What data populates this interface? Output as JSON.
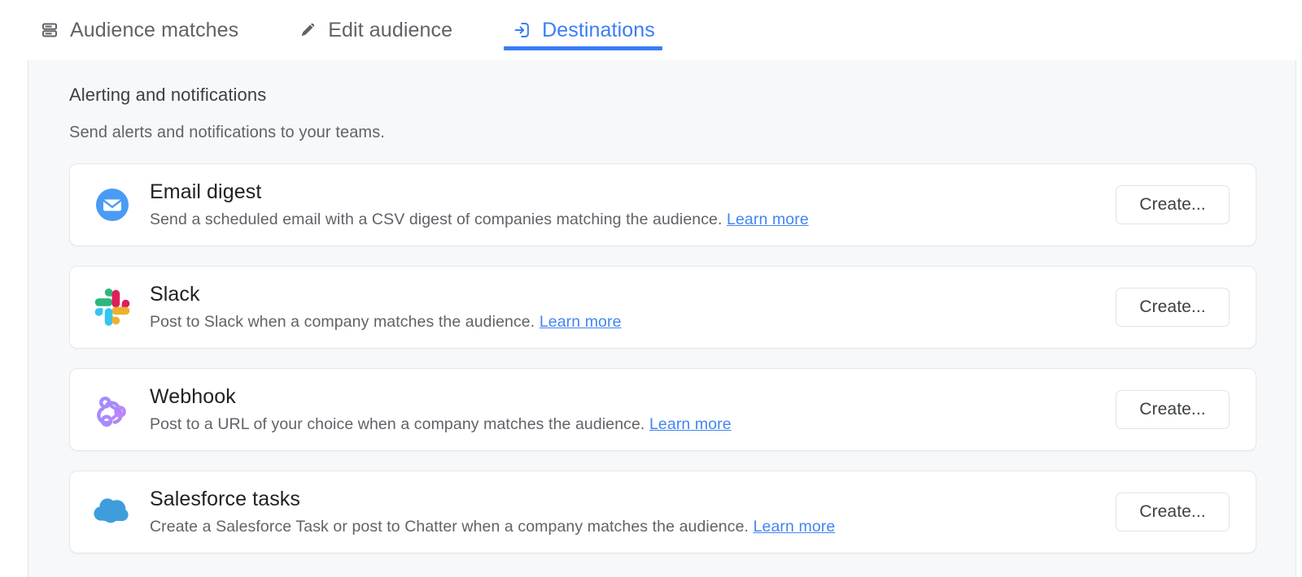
{
  "tabs": [
    {
      "id": "audience-matches",
      "label": "Audience matches",
      "icon": "layers-icon",
      "active": false
    },
    {
      "id": "edit-audience",
      "label": "Edit audience",
      "icon": "pencil-icon",
      "active": false
    },
    {
      "id": "destinations",
      "label": "Destinations",
      "icon": "arrow-into-box-icon",
      "active": true
    }
  ],
  "section": {
    "title": "Alerting and notifications",
    "subtitle": "Send alerts and notifications to your teams."
  },
  "link_label": "Learn more",
  "button_label": "Create...",
  "colors": {
    "accent": "#3b7df6",
    "link": "#4285f4",
    "panel_bg": "#f7f8fa",
    "card_bg": "#ffffff",
    "email_icon": "#4a9bf5",
    "salesforce_icon": "#3f9ddb",
    "webhook_icon": "#a78bfa",
    "slack_blue": "#36c5f0",
    "slack_green": "#2eb67d",
    "slack_red": "#e01e5a",
    "slack_yellow": "#ecb22e"
  },
  "destinations": [
    {
      "id": "email-digest",
      "title": "Email digest",
      "description": "Send a scheduled email with a CSV digest of companies matching the audience.",
      "link_label": "Learn more",
      "button_label": "Create...",
      "icon": "email-icon"
    },
    {
      "id": "slack",
      "title": "Slack",
      "description": "Post to Slack when a company matches the audience.",
      "link_label": "Learn more",
      "button_label": "Create...",
      "icon": "slack-icon"
    },
    {
      "id": "webhook",
      "title": "Webhook",
      "description": "Post to a URL of your choice when a company matches the audience.",
      "link_label": "Learn more",
      "button_label": "Create...",
      "icon": "webhook-icon"
    },
    {
      "id": "salesforce-tasks",
      "title": "Salesforce tasks",
      "description": "Create a Salesforce Task or post to Chatter when a company matches the audience.",
      "link_label": "Learn more",
      "button_label": "Create...",
      "icon": "salesforce-cloud-icon"
    }
  ]
}
